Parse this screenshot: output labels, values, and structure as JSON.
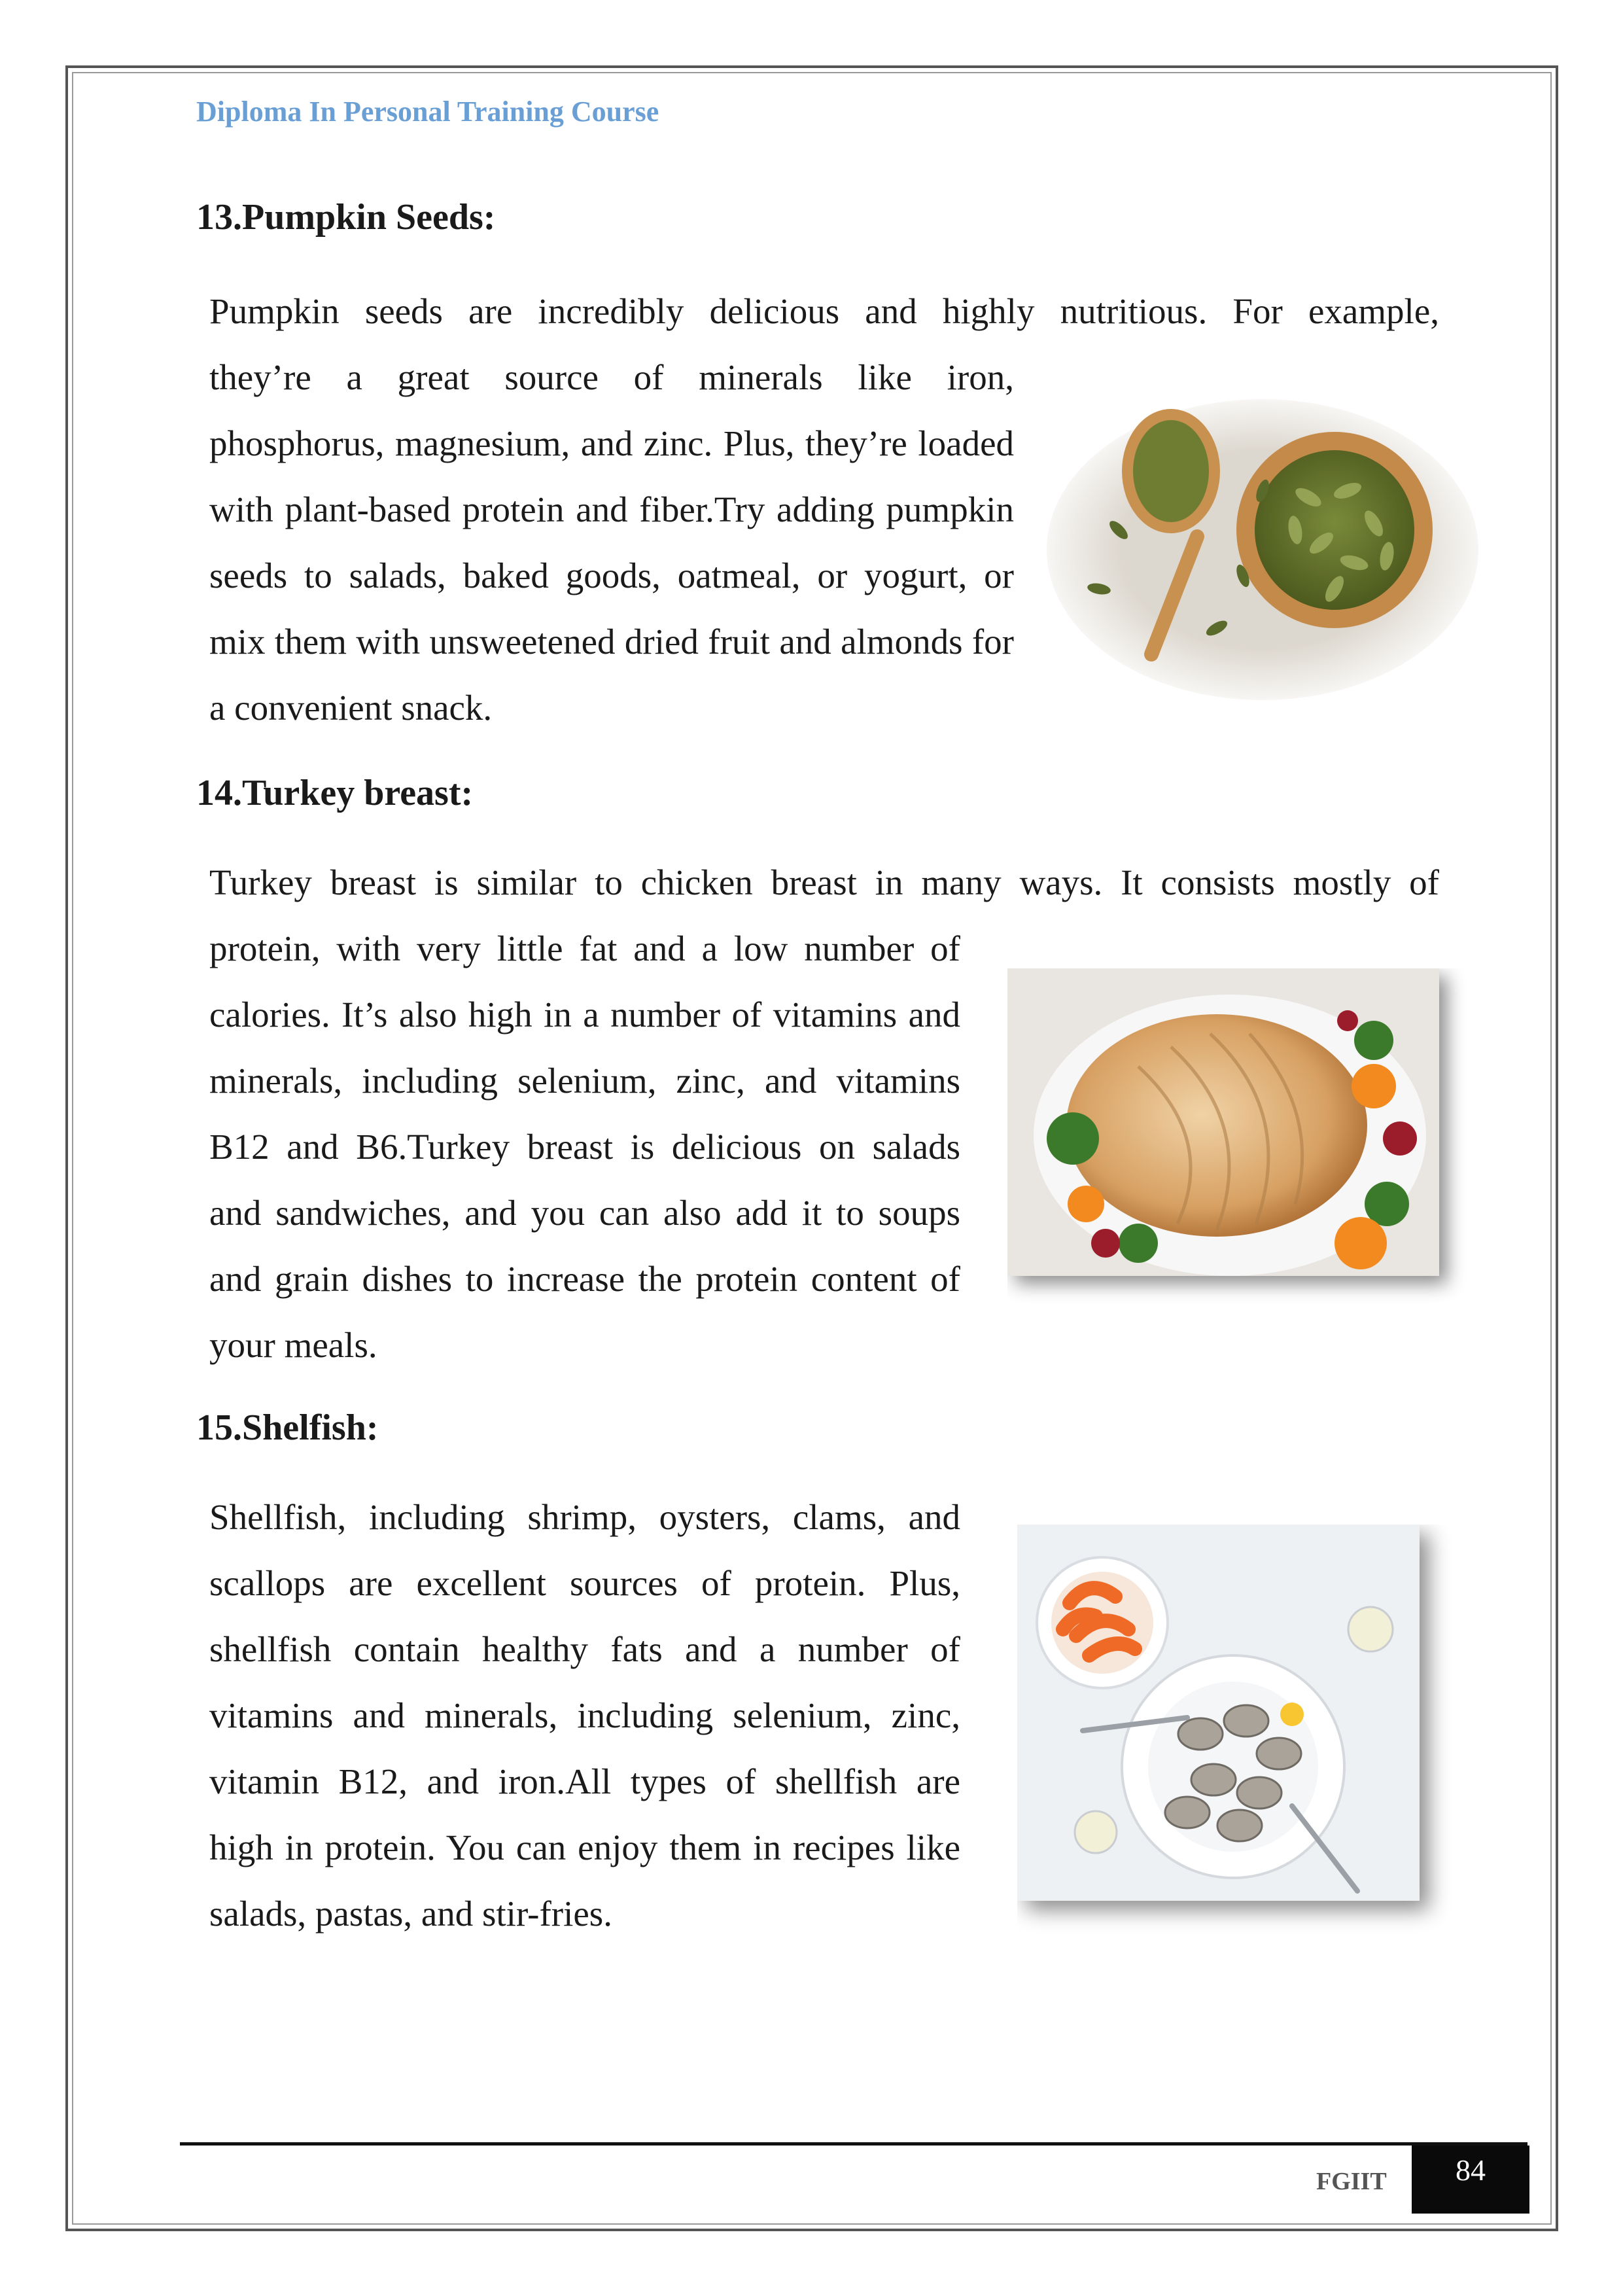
{
  "header": {
    "title": "Diploma In Personal Training Course"
  },
  "sections": [
    {
      "heading": "13.Pumpkin Seeds:",
      "first_line": "Pumpkin seeds are incredibly delicious and highly nutritious. For example,",
      "body": "they’re a great source of minerals like iron, phosphorus, magnesium, and zinc. Plus, they’re loaded with plant-based protein and fiber.Try adding pumpkin seeds to salads, baked goods, oatmeal, or yogurt, or mix them with unsweetened dried fruit and almonds for a convenient snack.",
      "image": "pumpkin-seeds-photo"
    },
    {
      "heading": "14.Turkey breast:",
      "first_line": "Turkey breast is similar to chicken breast in many ways. It consists mostly of",
      "body": "protein, with very little fat and a low number of calories. It’s also high in a number of vitamins and minerals, including selenium, zinc, and vitamins B12 and B6.Turkey breast is delicious on salads and sandwiches, and you can also add it to soups and grain dishes to increase the protein content of your meals.",
      "image": "turkey-breast-photo"
    },
    {
      "heading": "15.Shelfish:",
      "body": "Shellfish, including shrimp, oysters, clams, and scallops are excellent sources of protein. Plus, shellfish contain healthy fats and a number of vitamins and minerals, including selenium, zinc, vitamin B12, and iron.All types of shellfish are high in protein. You can enjoy them in recipes like salads, pastas, and stir-fries.",
      "image": "shellfish-photo"
    }
  ],
  "footer": {
    "org": "FGIIT",
    "page_number": "84"
  }
}
